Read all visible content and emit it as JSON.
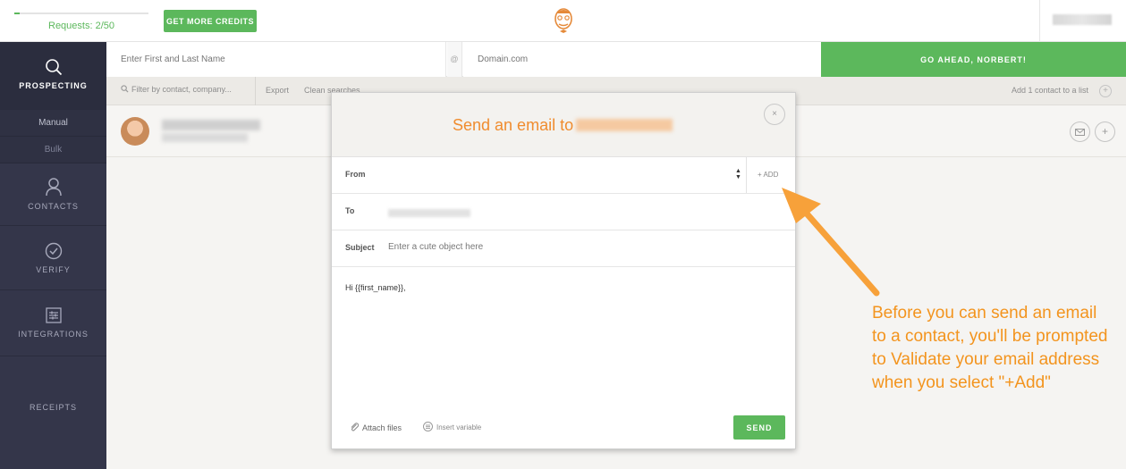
{
  "topbar": {
    "requests_text": "Requests: 2/50",
    "requests_used": 2,
    "requests_total": 50,
    "get_credits_label": "GET MORE CREDITS"
  },
  "sidebar": {
    "items": [
      {
        "label": "PROSPECTING",
        "icon": "search-icon"
      },
      {
        "label": "CONTACTS",
        "icon": "user-icon"
      },
      {
        "label": "VERIFY",
        "icon": "check-circle-icon"
      },
      {
        "label": "INTEGRATIONS",
        "icon": "sliders-icon"
      },
      {
        "label": "RECEIPTS",
        "icon": ""
      }
    ],
    "subitems": [
      {
        "label": "Manual"
      },
      {
        "label": "Bulk"
      }
    ]
  },
  "search": {
    "name_placeholder": "Enter First and Last Name",
    "at": "@",
    "domain_placeholder": "Domain.com",
    "go_label": "GO AHEAD, NORBERT!"
  },
  "filter": {
    "placeholder": "Filter by contact, company...",
    "export_label": "Export",
    "clean_label": "Clean searches",
    "add_list_label": "Add 1 contact to a list",
    "plus": "+"
  },
  "modal": {
    "title": "Send an email to",
    "close": "×",
    "from_label": "From",
    "add_label": "+ ADD",
    "to_label": "To",
    "subject_label": "Subject",
    "subject_placeholder": "Enter a cute object here",
    "body_text": "Hi {{first_name}},",
    "attach_label": "Attach files",
    "insert_variable_label": "Insert variable",
    "send_label": "SEND"
  },
  "annotation": {
    "text": "Before you can send an email to a contact, you'll be prompted to Validate your email address when you select \"+Add\""
  },
  "colors": {
    "accent_green": "#5cb85c",
    "sidebar_bg": "#34364a",
    "orange": "#f08c2e"
  }
}
